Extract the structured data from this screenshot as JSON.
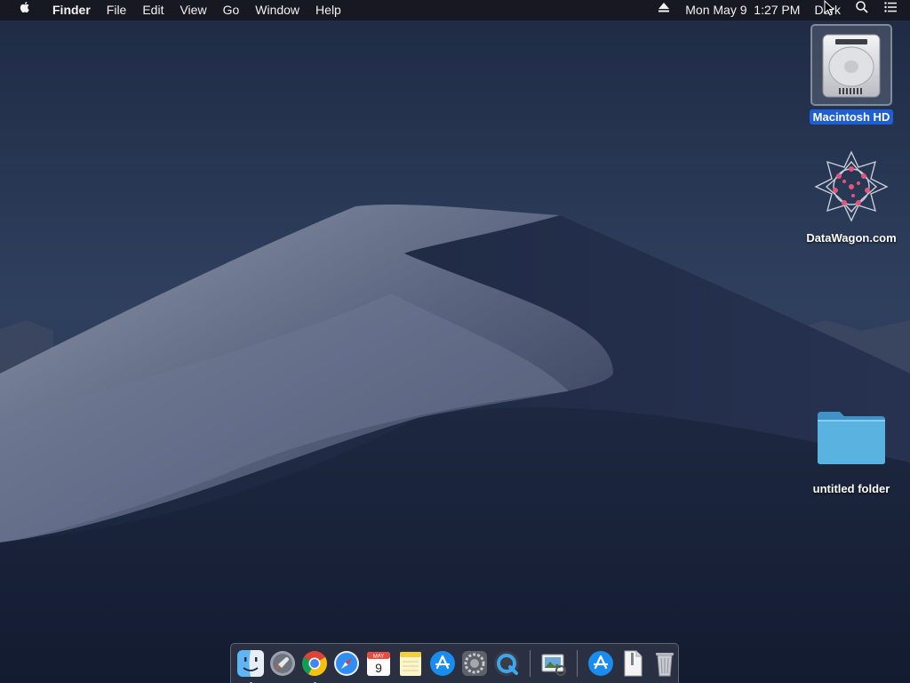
{
  "menubar": {
    "apple_icon": "apple-logo-icon",
    "app_name": "Finder",
    "menus": [
      "File",
      "Edit",
      "View",
      "Go",
      "Window",
      "Help"
    ],
    "eject_icon": "eject-icon",
    "datetime": "Mon May 9  1:27 PM",
    "user": "Dark",
    "spotlight_icon": "spotlight-search-icon",
    "notification_icon": "notification-center-icon"
  },
  "desktop": {
    "icons": [
      {
        "label": "Macintosh HD",
        "icon": "hard-drive-icon",
        "selected": true
      },
      {
        "label": "DataWagon.com",
        "icon": "datawagon-logo-icon",
        "selected": false
      },
      {
        "label": "untitled folder",
        "icon": "folder-icon",
        "selected": false
      }
    ]
  },
  "dock": {
    "apps": [
      {
        "name": "Finder",
        "icon": "finder-icon",
        "running": true
      },
      {
        "name": "Launchpad",
        "icon": "launchpad-icon",
        "running": false
      },
      {
        "name": "Google Chrome",
        "icon": "chrome-icon",
        "running": true
      },
      {
        "name": "Safari",
        "icon": "safari-icon",
        "running": false
      },
      {
        "name": "Calendar",
        "icon": "calendar-icon",
        "running": false,
        "month": "MAY",
        "day": "9"
      },
      {
        "name": "Notes",
        "icon": "notes-icon",
        "running": false
      },
      {
        "name": "App Store",
        "icon": "app-store-icon",
        "running": false
      },
      {
        "name": "System Preferences",
        "icon": "system-preferences-icon",
        "running": false
      },
      {
        "name": "QuickTime Player",
        "icon": "quicktime-icon",
        "running": false
      },
      {
        "name": "Preview",
        "icon": "preview-icon",
        "running": false
      },
      {
        "name": "Applications",
        "icon": "applications-folder-icon",
        "running": false
      },
      {
        "name": "Document",
        "icon": "document-icon",
        "running": false
      },
      {
        "name": "Trash",
        "icon": "trash-icon",
        "running": false
      }
    ]
  },
  "colors": {
    "selection": "#1f5fd6",
    "menubar": "#16181e",
    "folder": "#5ab2e0"
  }
}
